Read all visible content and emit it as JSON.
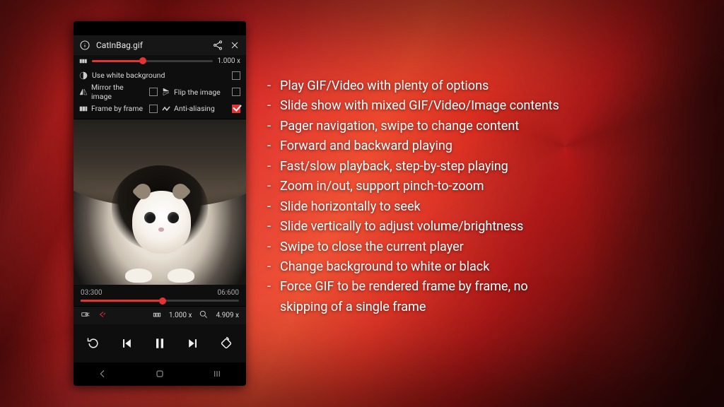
{
  "phone": {
    "filename": "CatInBag.gif",
    "speed_value": "1.000 x",
    "options": {
      "white_bg_label": "Use white background",
      "mirror_label": "Mirror the image",
      "flip_label": "Flip the image",
      "frame_label": "Frame by frame",
      "aa_label": "Anti-aliasing"
    },
    "time_current": "03:300",
    "time_total": "06:600",
    "info_speed": "1.000 x",
    "info_zoom": "4.909 x"
  },
  "features": {
    "items": [
      "Play GIF/Video with plenty of options",
      "Slide show with mixed GIF/Video/Image contents",
      "Pager navigation, swipe to change content",
      "Forward and backward playing",
      "Fast/slow playback, step-by-step playing",
      "Zoom in/out, support pinch-to-zoom",
      "Slide horizontally to seek",
      "Slide vertically to adjust volume/brightness",
      "Swipe to close the current player",
      "Change background to white or black"
    ],
    "last_line_a": "Force GIF to be rendered frame by frame, no",
    "last_line_b": "skipping of a single frame"
  }
}
